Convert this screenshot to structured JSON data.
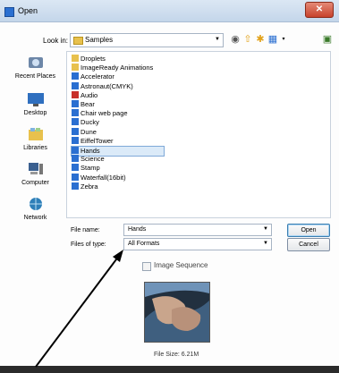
{
  "window": {
    "title": "Open"
  },
  "lookin": {
    "label": "Look in:",
    "value": "Samples"
  },
  "places": [
    {
      "label": "Recent Places",
      "icon": "recent-places-icon"
    },
    {
      "label": "Desktop",
      "icon": "desktop-icon"
    },
    {
      "label": "Libraries",
      "icon": "libraries-icon"
    },
    {
      "label": "Computer",
      "icon": "computer-icon"
    },
    {
      "label": "Network",
      "icon": "network-icon"
    }
  ],
  "files": [
    {
      "name": "Droplets",
      "type": "folder"
    },
    {
      "name": "ImageReady Animations",
      "type": "folder"
    },
    {
      "name": "Accelerator",
      "type": "ps"
    },
    {
      "name": "Astronaut(CMYK)",
      "type": "ps"
    },
    {
      "name": "Audio",
      "type": "audio"
    },
    {
      "name": "Bear",
      "type": "ps"
    },
    {
      "name": "Chair web page",
      "type": "ps"
    },
    {
      "name": "Ducky",
      "type": "ps"
    },
    {
      "name": "Dune",
      "type": "ps"
    },
    {
      "name": "EiffelTower",
      "type": "ps"
    },
    {
      "name": "Hands",
      "type": "ps",
      "selected": true
    },
    {
      "name": "Science",
      "type": "ps"
    },
    {
      "name": "Stamp",
      "type": "ps"
    },
    {
      "name": "Waterfall(16bit)",
      "type": "ps"
    },
    {
      "name": "Zebra",
      "type": "ps"
    }
  ],
  "form": {
    "filename_label": "File name:",
    "filename_value": "Hands",
    "filetype_label": "Files of type:",
    "filetype_value": "All Formats",
    "open_label": "Open",
    "cancel_label": "Cancel"
  },
  "preview": {
    "image_sequence_label": "Image Sequence",
    "filesize": "File Size: 6.21M"
  },
  "colors": {
    "selection": "#dbeaf8",
    "folder": "#e8c14d",
    "ps": "#2a6fd1",
    "annotation_arrow": "#000000"
  }
}
